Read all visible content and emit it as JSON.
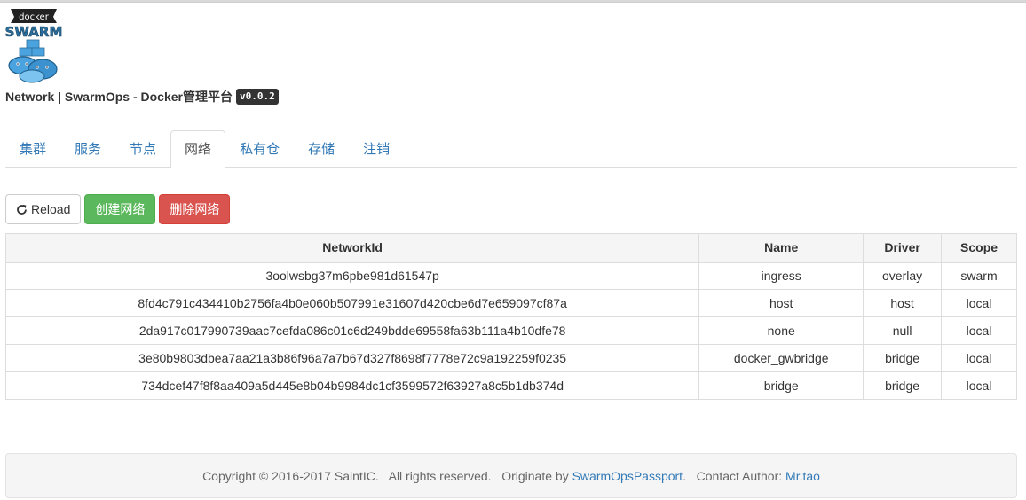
{
  "header": {
    "logo_text_top": "docker",
    "logo_text_main": "SWARM",
    "title": "Network | SwarmOps - Docker管理平台",
    "version": "v0.0.2"
  },
  "tabs": [
    {
      "label": "集群",
      "active": false
    },
    {
      "label": "服务",
      "active": false
    },
    {
      "label": "节点",
      "active": false
    },
    {
      "label": "网络",
      "active": true
    },
    {
      "label": "私有仓",
      "active": false
    },
    {
      "label": "存储",
      "active": false
    },
    {
      "label": "注销",
      "active": false
    }
  ],
  "toolbar": {
    "reload_label": "Reload",
    "reload_icon": "refresh-icon",
    "create_label": "创建网络",
    "delete_label": "删除网络"
  },
  "table": {
    "columns": [
      "NetworkId",
      "Name",
      "Driver",
      "Scope"
    ],
    "rows": [
      [
        "3oolwsbg37m6pbe981d61547p",
        "ingress",
        "overlay",
        "swarm"
      ],
      [
        "8fd4c791c434410b2756fa4b0e060b507991e31607d420cbe6d7e659097cf87a",
        "host",
        "host",
        "local"
      ],
      [
        "2da917c017990739aac7cefda086c01c6d249bdde69558fa63b111a4b10dfe78",
        "none",
        "null",
        "local"
      ],
      [
        "3e80b9803dbea7aa21a3b86f96a7a7b67d327f8698f7778e72c9a192259f0235",
        "docker_gwbridge",
        "bridge",
        "local"
      ],
      [
        "734dcef47f8f8aa409a5d445e8b04b9984dc1cf3599572f63927a8c5b1db374d",
        "bridge",
        "bridge",
        "local"
      ]
    ]
  },
  "footer": {
    "copyright": "Copyright © 2016-2017 SaintIC.   All rights reserved.   Originate by ",
    "link_swarmops": "SwarmOps",
    "link_passport": "Passport",
    "after_links": ".   Contact Author: ",
    "link_author": "Mr.tao"
  },
  "colors": {
    "link": "#337ab7",
    "success": "#5cb85c",
    "danger": "#d9534f"
  }
}
